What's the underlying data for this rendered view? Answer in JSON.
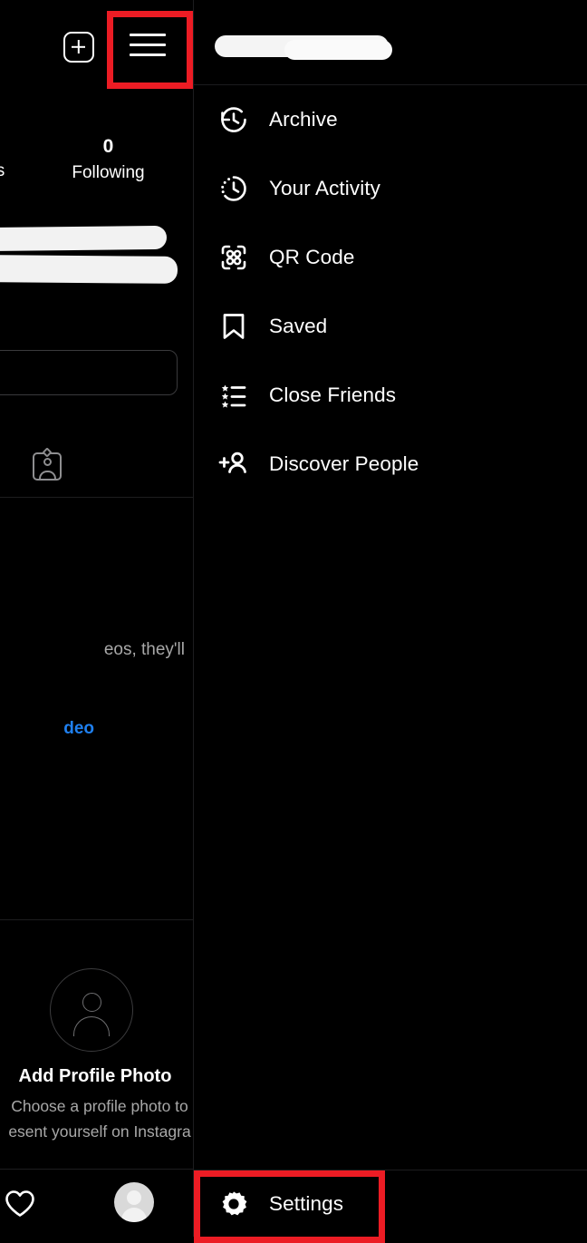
{
  "app": {
    "name": "Instagram",
    "theme": "dark",
    "background_color": "#000000",
    "accent_link_color": "#1f80f0",
    "highlight_box_color": "#ec1c24"
  },
  "profile": {
    "topbar": {
      "new_post_icon": "plus-square-icon",
      "menu_icon": "hamburger-menu-icon"
    },
    "stats": {
      "followers_label_partial": "ers",
      "following_count": "0",
      "following_label": "Following"
    },
    "name_redacted": true,
    "edit_profile_button_label": "",
    "tabs": {
      "tagged_icon": "tagged-photos-icon"
    },
    "empty_state": {
      "text_partial": "eos, they'll",
      "link_partial": "deo"
    },
    "add_profile_photo": {
      "title": "Add Profile Photo",
      "subtitle_line1": "Choose a profile photo to",
      "subtitle_line2": "esent yourself on Instagra"
    },
    "bottom_nav": {
      "activity_icon": "heart-icon",
      "profile_icon": "profile-avatar-icon"
    }
  },
  "drawer": {
    "header_title_redacted": true,
    "items": [
      {
        "label": "Archive",
        "icon": "archive-clock-icon"
      },
      {
        "label": "Your Activity",
        "icon": "activity-clock-icon"
      },
      {
        "label": "QR Code",
        "icon": "qr-code-icon"
      },
      {
        "label": "Saved",
        "icon": "bookmark-icon"
      },
      {
        "label": "Close Friends",
        "icon": "star-list-icon"
      },
      {
        "label": "Discover People",
        "icon": "person-plus-icon"
      }
    ],
    "settings": {
      "label": "Settings",
      "icon": "gear-icon"
    }
  },
  "annotations": [
    {
      "target": "hamburger-menu-icon",
      "color": "#ec1c24"
    },
    {
      "target": "settings-row",
      "color": "#ec1c24"
    }
  ]
}
